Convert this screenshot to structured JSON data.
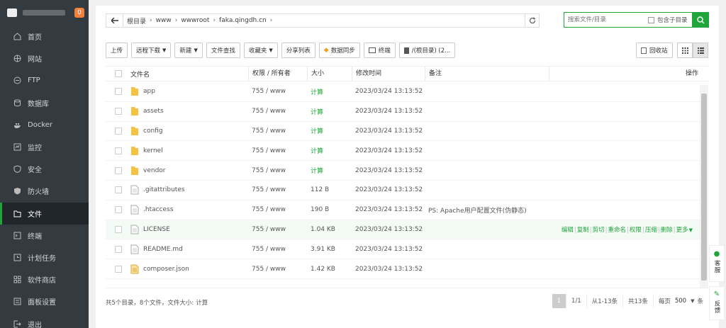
{
  "sidebar": {
    "badge": "0",
    "items": [
      {
        "label": "首页",
        "icon": "home-icon"
      },
      {
        "label": "网站",
        "icon": "globe-icon"
      },
      {
        "label": "FTP",
        "icon": "ftp-icon"
      },
      {
        "label": "数据库",
        "icon": "database-icon"
      },
      {
        "label": "Docker",
        "icon": "docker-icon"
      },
      {
        "label": "监控",
        "icon": "monitor-icon"
      },
      {
        "label": "安全",
        "icon": "shield-icon"
      },
      {
        "label": "防火墙",
        "icon": "firewall-icon"
      },
      {
        "label": "文件",
        "icon": "folder-icon",
        "active": true
      },
      {
        "label": "终端",
        "icon": "terminal-icon"
      },
      {
        "label": "计划任务",
        "icon": "clock-icon"
      },
      {
        "label": "软件商店",
        "icon": "apps-icon"
      },
      {
        "label": "面板设置",
        "icon": "settings-icon"
      },
      {
        "label": "退出",
        "icon": "logout-icon"
      }
    ]
  },
  "path": {
    "crumbs": [
      "根目录",
      "www",
      "wwwroot",
      "faka.qingdh.cn"
    ]
  },
  "search": {
    "placeholder": "搜索文件/目录",
    "subdir_label": "包含子目录"
  },
  "toolbar": {
    "upload": "上传",
    "remote_download": "远程下载",
    "new": "新建",
    "file_search": "文件查找",
    "favorites": "收藏夹",
    "share_list": "分享列表",
    "data_sync": "数据同步",
    "terminal": "终端",
    "disk": "/(根目录) (2...",
    "recycle": "回收站"
  },
  "table": {
    "headers": {
      "name": "文件名",
      "perm": "权限 / 所有者",
      "size": "大小",
      "mtime": "修改时间",
      "note": "备注",
      "actions": "操作"
    },
    "rows": [
      {
        "name": "app",
        "type": "folder",
        "perm": "755 / www",
        "size": "计算",
        "mtime": "2023/03/24 13:13:52",
        "note": ""
      },
      {
        "name": "assets",
        "type": "folder",
        "perm": "755 / www",
        "size": "计算",
        "mtime": "2023/03/24 13:13:52",
        "note": ""
      },
      {
        "name": "config",
        "type": "folder",
        "perm": "755 / www",
        "size": "计算",
        "mtime": "2023/03/24 13:13:52",
        "note": ""
      },
      {
        "name": "kernel",
        "type": "folder",
        "perm": "755 / www",
        "size": "计算",
        "mtime": "2023/03/24 13:13:52",
        "note": ""
      },
      {
        "name": "vendor",
        "type": "folder",
        "perm": "755 / www",
        "size": "计算",
        "mtime": "2023/03/24 13:13:52",
        "note": ""
      },
      {
        "name": ".gitattributes",
        "type": "file",
        "perm": "755 / www",
        "size": "112 B",
        "mtime": "2023/03/24 13:13:52",
        "note": ""
      },
      {
        "name": ".htaccess",
        "type": "file",
        "perm": "755 / www",
        "size": "190 B",
        "mtime": "2023/03/24 13:13:52",
        "note": "PS: Apache用户配置文件(伪静态)"
      },
      {
        "name": "LICENSE",
        "type": "file",
        "perm": "755 / www",
        "size": "1.04 KB",
        "mtime": "2023/03/24 13:13:52",
        "note": ""
      },
      {
        "name": "README.md",
        "type": "file",
        "perm": "755 / www",
        "size": "3.91 KB",
        "mtime": "2023/03/24 13:13:52",
        "note": ""
      },
      {
        "name": "composer.json",
        "type": "json",
        "perm": "755 / www",
        "size": "1.42 KB",
        "mtime": "2023/03/24 13:13:52",
        "note": ""
      }
    ],
    "row_ops": [
      "编辑",
      "复制",
      "剪切",
      "重命名",
      "权限",
      "压缩",
      "删除",
      "更多"
    ]
  },
  "footer": {
    "summary": "共5个目录，8个文件，文件大小:",
    "calc": "计算",
    "page_current": "1",
    "page_of": "1/1",
    "range": "从1-13条",
    "total": "共13条",
    "per_page_label": "每页",
    "per_page": "500",
    "per_page_unit": "条"
  },
  "floats": {
    "service": "客服",
    "feedback": "反馈"
  },
  "colors": {
    "accent": "#20a53a",
    "sidebar_bg": "#333a40",
    "badge": "#f0813c",
    "folder": "#f5c242"
  }
}
